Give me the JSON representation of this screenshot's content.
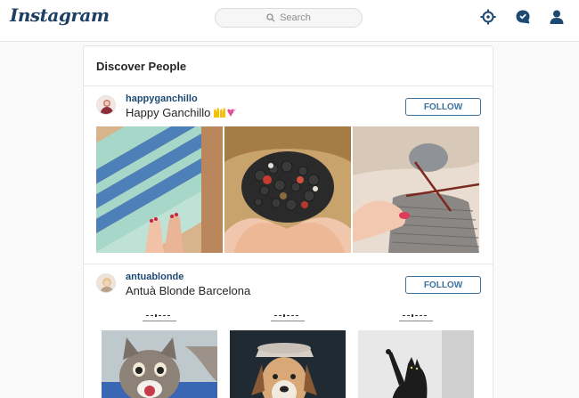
{
  "header": {
    "logo": "Instagram",
    "search_placeholder": "Search",
    "icons": [
      "explore-icon",
      "activity-icon",
      "profile-icon"
    ]
  },
  "discover": {
    "title": "Discover People"
  },
  "people": [
    {
      "username": "happyganchillo",
      "full_name": "Happy Ganchillo",
      "follow_label": "FOLLOW"
    },
    {
      "username": "antuablonde",
      "full_name": "Antuà Blonde Barcelona",
      "follow_label": "FOLLOW"
    }
  ],
  "colors": {
    "brand": "#1d3f63",
    "link": "#3f729b",
    "background": "#fafafa"
  }
}
